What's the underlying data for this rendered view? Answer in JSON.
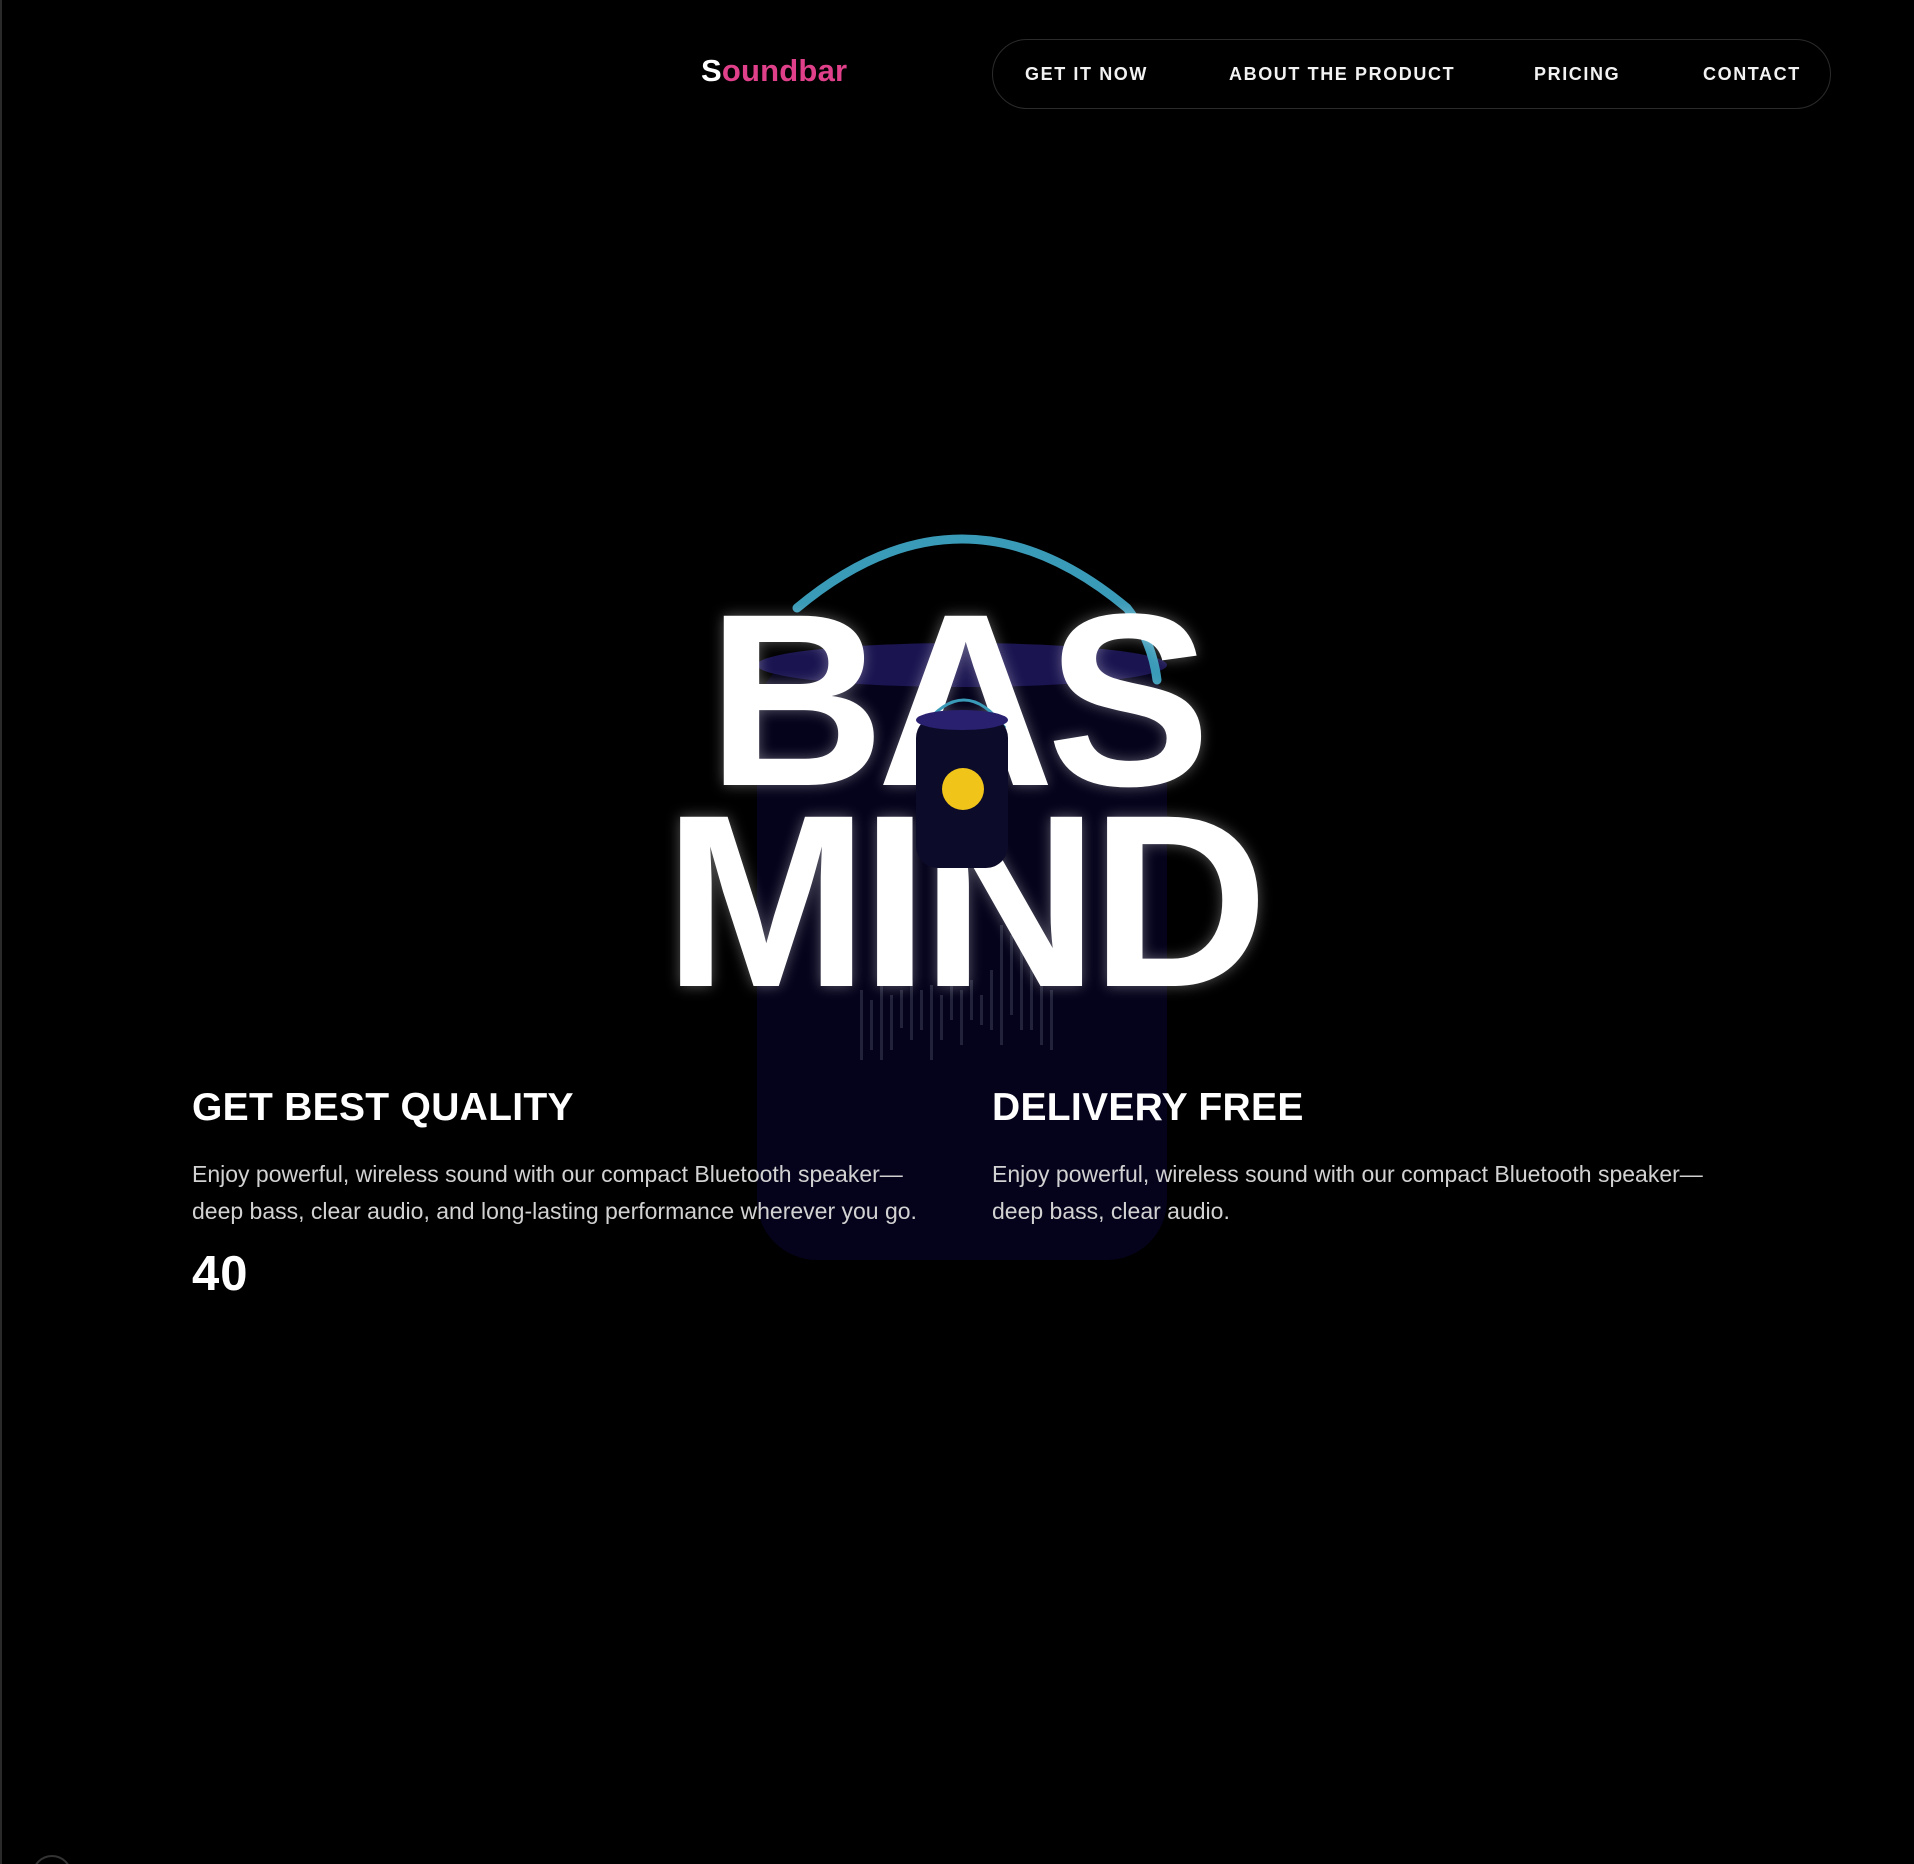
{
  "brand": {
    "logo_first": "S",
    "logo_rest": "oundbar",
    "accent_color": "#e0408a"
  },
  "nav": {
    "items": [
      {
        "label": "GET IT NOW"
      },
      {
        "label": "ABOUT THE PRODUCT"
      },
      {
        "label": "PRICING"
      },
      {
        "label": "CONTACT"
      }
    ]
  },
  "hero": {
    "line1": "BAS",
    "line2": "MIND",
    "colors": {
      "arc": "#3a9bb8",
      "speaker_body": "#0d0b2a",
      "speaker_dot": "#f0c419"
    }
  },
  "features": [
    {
      "title": "GET BEST QUALITY",
      "body": "Enjoy powerful, wireless sound with our compact Bluetooth speaker—deep bass, clear audio, and long-lasting performance wherever you go.",
      "stat": "40"
    },
    {
      "title": "DELIVERY FREE",
      "body": "Enjoy powerful, wireless sound with our compact Bluetooth speaker—deep bass, clear audio."
    }
  ]
}
